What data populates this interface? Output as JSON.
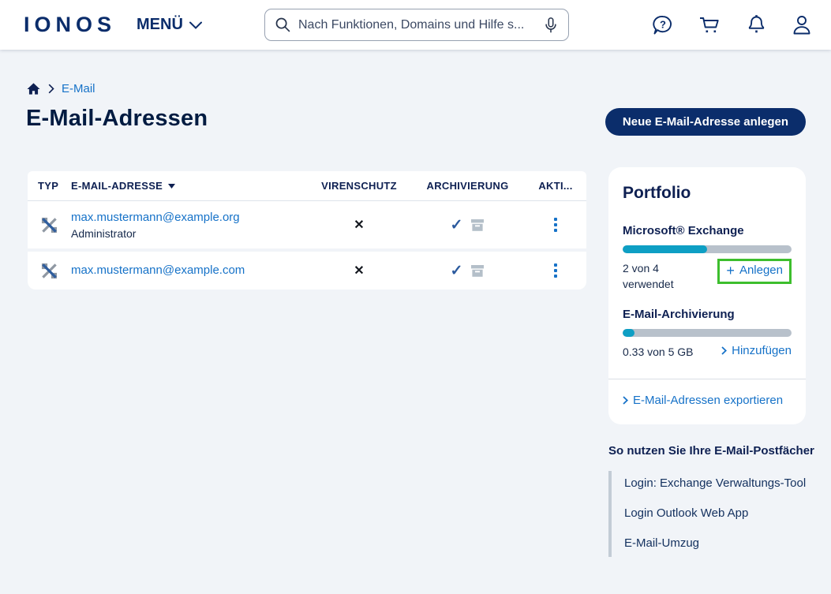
{
  "colors": {
    "brand_navy": "#0b2d6b",
    "heading_navy": "#0e2052",
    "link_blue": "#1672c8",
    "progress_teal": "#0e9fc4",
    "progress_track": "#b8c1cb",
    "highlight_green": "#3dbe2d",
    "page_bg": "#f1f4f8"
  },
  "header": {
    "logo_text": "IONOS",
    "menu_label": "MENÜ",
    "search_placeholder": "Nach Funktionen, Domains und Hilfe s...",
    "icons": [
      "help-chat-icon",
      "cart-icon",
      "bell-icon",
      "account-icon"
    ]
  },
  "breadcrumb": {
    "section": "E-Mail"
  },
  "page": {
    "title": "E-Mail-Adressen",
    "new_address_button": "Neue E-Mail-Adresse anlegen"
  },
  "table": {
    "headers": {
      "typ": "TYP",
      "email": "E-MAIL-ADRESSE",
      "virenschutz": "VIRENSCHUTZ",
      "archivierung": "ARCHIVIERUNG",
      "aktionen": "AKTI..."
    },
    "rows": [
      {
        "type_icon": "exchange-icon",
        "email": "max.mustermann@example.org",
        "role": "Administrator",
        "virenschutz": "✕",
        "archivierung": "✓"
      },
      {
        "type_icon": "exchange-icon",
        "email": "max.mustermann@example.com",
        "role": "",
        "virenschutz": "✕",
        "archivierung": "✓"
      }
    ]
  },
  "portfolio": {
    "title": "Portfolio",
    "exchange": {
      "name": "Microsoft® Exchange",
      "used_line1": "2 von 4",
      "used_line2": "verwendet",
      "action_label": "Anlegen",
      "progress_percent": 50
    },
    "archiving": {
      "name": "E-Mail-Archivierung",
      "used": "0.33 von 5 GB",
      "action_label": "Hinzufügen",
      "progress_percent": 7
    },
    "export_link": "E-Mail-Adressen exportieren"
  },
  "help": {
    "title": "So nutzen Sie Ihre E-Mail-Postfächer",
    "links": [
      {
        "label": "Login: Exchange Verwaltungs-Tool"
      },
      {
        "label": "Login Outlook Web App"
      },
      {
        "label": "E-Mail-Umzug"
      }
    ]
  }
}
